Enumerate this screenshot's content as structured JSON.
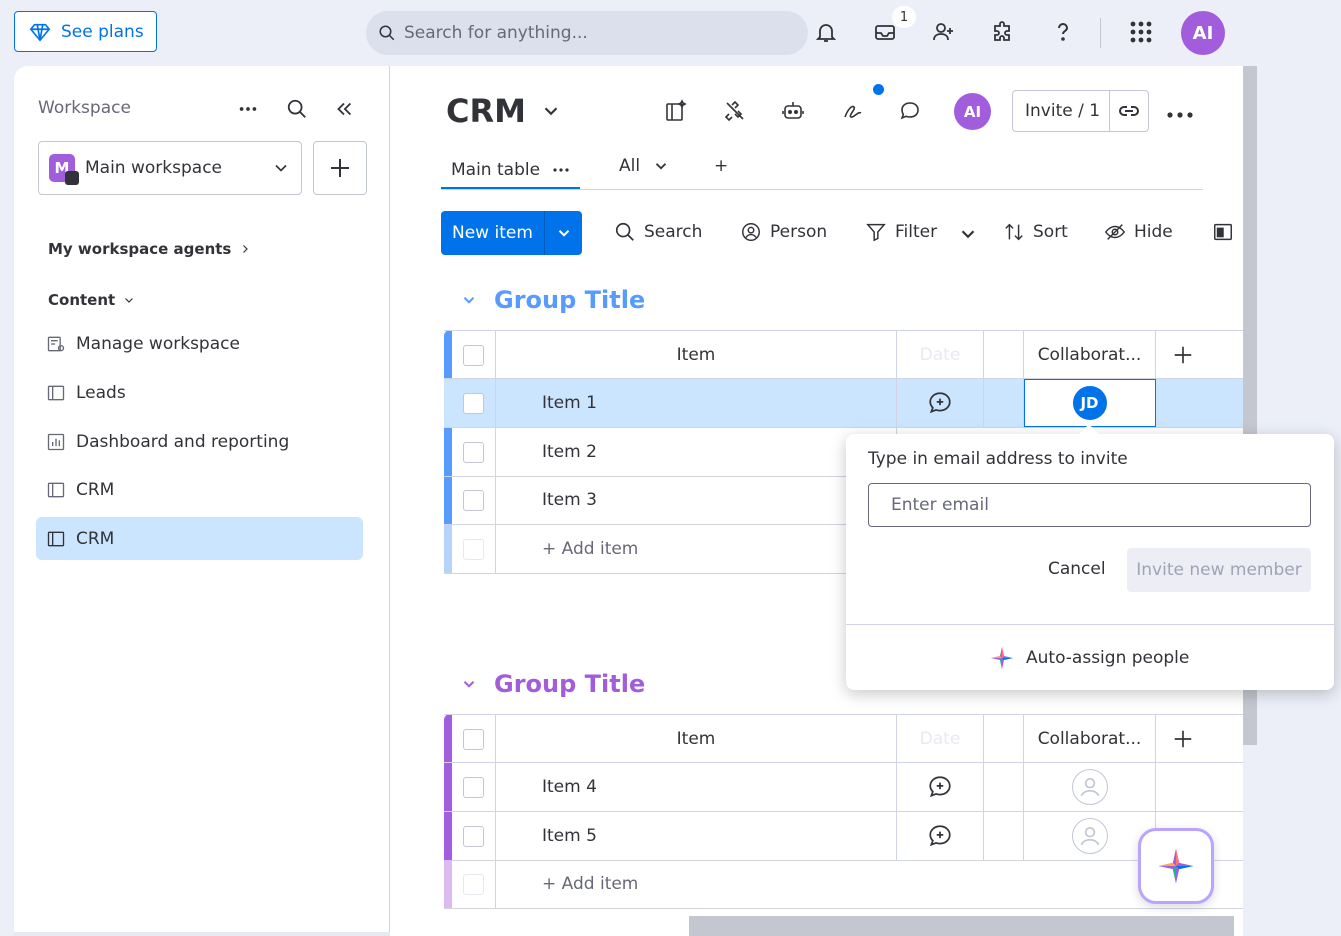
{
  "topbar": {
    "see_plans": "See plans",
    "search_placeholder": "Search for anything...",
    "inbox_count": "1",
    "avatar_initials": "AI"
  },
  "sidebar": {
    "workspace_label": "Workspace",
    "workspace_name": "Main workspace",
    "workspace_initial": "M",
    "agents_heading": "My workspace agents",
    "content_heading": "Content",
    "items": [
      {
        "label": "Manage workspace",
        "icon": "manage-icon"
      },
      {
        "label": "Leads",
        "icon": "board-icon"
      },
      {
        "label": "Dashboard and reporting",
        "icon": "dashboard-icon"
      },
      {
        "label": "CRM",
        "icon": "board-icon"
      },
      {
        "label": "CRM",
        "icon": "board-icon",
        "active": true
      }
    ]
  },
  "board": {
    "title": "CRM",
    "avatar_initials": "AI",
    "invite_label": "Invite / 1",
    "tabs": {
      "main": "Main table",
      "view": "All",
      "add": "+"
    },
    "toolbar": {
      "new_item": "New item",
      "search": "Search",
      "person": "Person",
      "filter": "Filter",
      "sort": "Sort",
      "hide": "Hide"
    },
    "columns": {
      "item": "Item",
      "date": "Date",
      "collaborators": "Collaborat..."
    },
    "groups": [
      {
        "title": "Group Title",
        "color": "#579bfc",
        "title_color": "#579bfc",
        "items": [
          "Item 1",
          "Item 2",
          "Item 3"
        ],
        "add_item": "+ Add item"
      },
      {
        "title": "Group Title",
        "color": "#a25ddc",
        "title_color": "#a25ddc",
        "items": [
          "Item 4",
          "Item 5"
        ],
        "add_item": "+ Add item"
      }
    ],
    "assigned_initials": "JD"
  },
  "popup": {
    "label": "Type in email address to invite",
    "placeholder": "Enter email",
    "cancel": "Cancel",
    "invite": "Invite new member",
    "auto_assign": "Auto-assign people"
  },
  "colors": {
    "accent": "#0073ea",
    "selected_row": "#cce5ff"
  }
}
